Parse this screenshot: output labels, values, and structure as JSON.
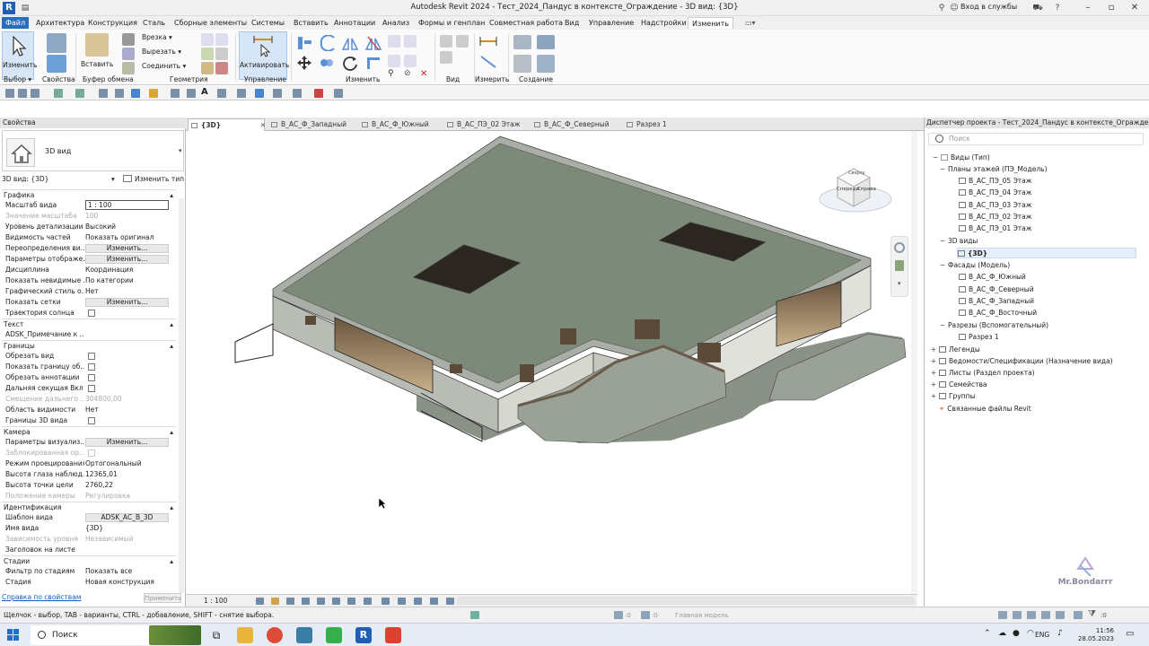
{
  "window": {
    "title": "Autodesk Revit 2024 - Тест_2024_Пандус в контексте_Ограждение - 3D вид: {3D}",
    "sign_in": "Вход в службы"
  },
  "menu_tabs": [
    {
      "label": "Файл"
    },
    {
      "label": "Архитектура"
    },
    {
      "label": "Конструкция"
    },
    {
      "label": "Сталь"
    },
    {
      "label": "Сборные элементы"
    },
    {
      "label": "Системы"
    },
    {
      "label": "Вставить"
    },
    {
      "label": "Аннотации"
    },
    {
      "label": "Анализ"
    },
    {
      "label": "Формы и генплан"
    },
    {
      "label": "Совместная работа"
    },
    {
      "label": "Вид"
    },
    {
      "label": "Управление"
    },
    {
      "label": "Надстройки"
    },
    {
      "label": "Изменить"
    }
  ],
  "ribbon": {
    "modify_label": "Изменить",
    "paste_label": "Вставить",
    "cut_label": "Врезка",
    "cut2_label": "Вырезать",
    "join_label": "Соединить",
    "activate_label": "Активировать",
    "groups": {
      "select": "Выбор",
      "properties": "Свойства",
      "clipboard": "Буфер обмена",
      "geometry": "Геометрия",
      "control": "Управление",
      "modify": "Изменить",
      "view": "Вид",
      "measure": "Измерить",
      "create": "Создание"
    }
  },
  "properties": {
    "title": "Свойства",
    "type_name": "3D вид",
    "instance_filter": "3D вид: {3D}",
    "edit_type": "Изменить тип",
    "help_link": "Справка по свойствам",
    "apply": "Применить",
    "sections": {
      "graphics": "Графика",
      "text": "Текст",
      "extents": "Границы",
      "camera": "Камера",
      "identity": "Идентификация",
      "phasing": "Стадии"
    },
    "rows": {
      "scale": {
        "k": "Масштаб вида",
        "v": "1 : 100"
      },
      "scale_value": {
        "k": "Значение масштаба",
        "v": "100"
      },
      "detail": {
        "k": "Уровень детализации",
        "v": "Высокий"
      },
      "parts": {
        "k": "Видимость частей",
        "v": "Показать оригинал"
      },
      "vg_overrides": {
        "k": "Переопределения ви...",
        "v": "Изменить..."
      },
      "display": {
        "k": "Параметры отображе...",
        "v": "Изменить..."
      },
      "discipline": {
        "k": "Дисциплина",
        "v": "Координация"
      },
      "hidden_lines": {
        "k": "Показать невидимые ...",
        "v": "По категории"
      },
      "graphic_style": {
        "k": "Графический стиль о...",
        "v": "Нет"
      },
      "grids": {
        "k": "Показать сетки",
        "v": "Изменить..."
      },
      "sun_path": {
        "k": "Траектория солнца"
      },
      "adsk_note": {
        "k": "ADSK_Примечание к ..."
      },
      "crop_view": {
        "k": "Обрезать вид"
      },
      "crop_region": {
        "k": "Показать границу об..."
      },
      "annot_crop": {
        "k": "Обрезать аннотации"
      },
      "far_clip": {
        "k": "Дальняя секущая Вкл"
      },
      "far_offset": {
        "k": "Смещение дальнего ...",
        "v": "304800,00"
      },
      "scope_box": {
        "k": "Область видимости",
        "v": "Нет"
      },
      "section_box": {
        "k": "Границы 3D вида"
      },
      "render": {
        "k": "Параметры визуализ...",
        "v": "Изменить..."
      },
      "locked": {
        "k": "Заблокированная ор..."
      },
      "projection": {
        "k": "Режим проецирования",
        "v": "Ортогональный"
      },
      "eye_elev": {
        "k": "Высота глаза наблюд...",
        "v": "12365,01"
      },
      "target_elev": {
        "k": "Высота точки цели",
        "v": "2760,22"
      },
      "camera_pos": {
        "k": "Положение камеры",
        "v": "Регулировка"
      },
      "template": {
        "k": "Шаблон вида",
        "v": "ADSK_АС_В_3D"
      },
      "view_name": {
        "k": "Имя вида",
        "v": "{3D}"
      },
      "dependency": {
        "k": "Зависимость уровня",
        "v": "Независимый"
      },
      "title_on_sheet": {
        "k": "Заголовок на листе"
      },
      "phase_filter": {
        "k": "Фильтр по стадиям",
        "v": "Показать все"
      },
      "phase": {
        "k": "Стадия",
        "v": "Новая конструкция"
      }
    }
  },
  "view_tabs": [
    {
      "label": "{3D}"
    },
    {
      "label": "В_АС_Ф_Западный"
    },
    {
      "label": "В_АС_Ф_Южный"
    },
    {
      "label": "В_АС_ПЭ_02 Этаж"
    },
    {
      "label": "В_АС_Ф_Северный"
    },
    {
      "label": "Разрез 1"
    }
  ],
  "viewcube": {
    "front": "Спереди",
    "right": "Справа",
    "top": "Сверху"
  },
  "view_bar": {
    "scale": "1 : 100"
  },
  "browser": {
    "title": "Диспетчер проекта - Тест_2024_Пандус в контексте_Ограждение",
    "search_placeholder": "Поиск",
    "nodes": {
      "views": "Виды (Тип)",
      "floor_plans": "Планы этажей (ПЭ_Модель)",
      "fp5": "В_АС_ПЭ_05 Этаж",
      "fp4": "В_АС_ПЭ_04 Этаж",
      "fp3": "В_АС_ПЭ_03 Этаж",
      "fp2": "В_АС_ПЭ_02 Этаж",
      "fp1": "В_АС_ПЭ_01 Этаж",
      "views3d": "3D виды",
      "v3d": "{3D}",
      "elevations": "Фасады (Модель)",
      "el_south": "В_АС_Ф_Южный",
      "el_north": "В_АС_Ф_Северный",
      "el_west": "В_АС_Ф_Западный",
      "el_east": "В_АС_Ф_Восточный",
      "sections": "Разрезы (Вспомогательный)",
      "section1": "Разрез 1",
      "legends": "Легенды",
      "schedules": "Ведомости/Спецификации (Назначение вида)",
      "sheets": "Листы (Раздел проекта)",
      "families": "Семейства",
      "groups": "Группы",
      "links": "Связанные файлы Revit"
    }
  },
  "watermark": "Mr.Bondarrr",
  "status": {
    "hint": "Щелчок - выбор, TAB - варианты, CTRL - добавление, SHIFT - снятие выбора.",
    "model": "Главная модель",
    "zero1": ":0",
    "zero2": ":0"
  },
  "taskbar": {
    "search": "Поиск",
    "lang": "ENG",
    "time": "11:56",
    "date": "28.05.2023"
  },
  "colors": {
    "accent": "#2a6ebb",
    "roof": "#7d8a79",
    "wall": "#c9ccc4"
  }
}
